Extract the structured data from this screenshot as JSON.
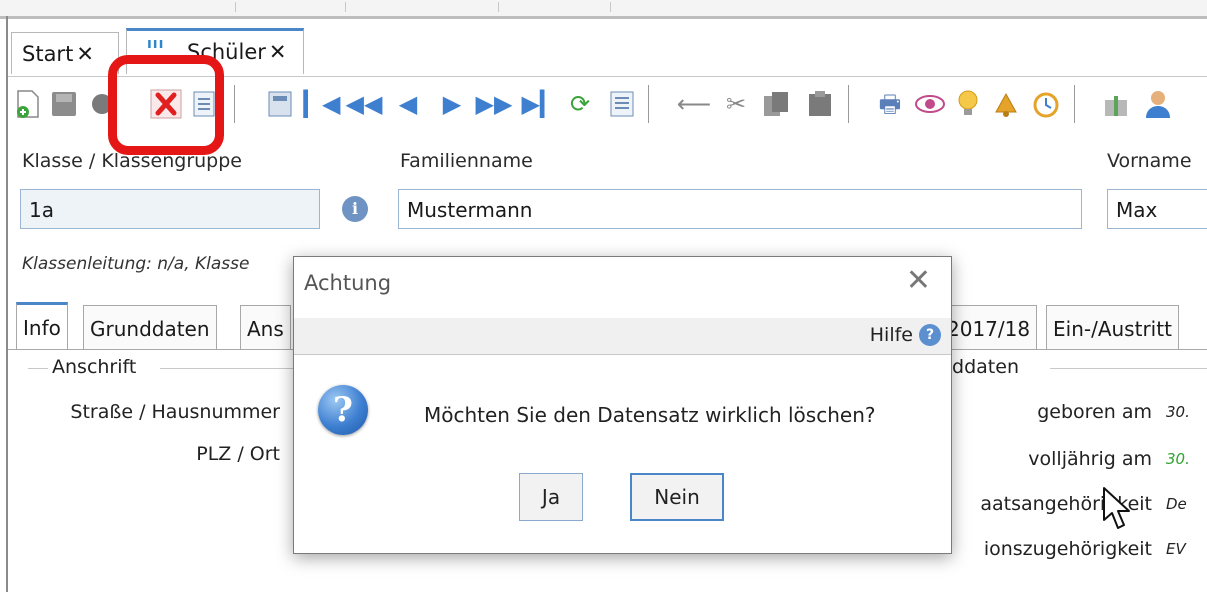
{
  "tabs": [
    {
      "label": "Start",
      "close": "✕"
    },
    {
      "label": "Schüler",
      "close": "✕"
    }
  ],
  "toolbar": {
    "icons": [
      "new-doc-icon",
      "save-icon",
      "undo-icon",
      "delete-icon",
      "edit-icon",
      "calculator-icon",
      "first-icon",
      "prev-page-icon",
      "prev-icon",
      "next-icon",
      "next-page-icon",
      "last-icon",
      "refresh-icon",
      "list-icon",
      "arrow-left-icon",
      "scissors-icon",
      "copy-icon",
      "paste-icon",
      "print-icon",
      "eye-icon",
      "bulb-icon",
      "bell-icon",
      "alarm-icon",
      "gift-icon",
      "user-icon"
    ]
  },
  "form": {
    "klasse_label": "Klasse / Klassengruppe",
    "klasse_value": "1a",
    "familienname_label": "Familienname",
    "familienname_value": "Mustermann",
    "vorname_label": "Vorname",
    "vorname_value": "Max",
    "info": "Klassenleitung: n/a, Klasse"
  },
  "detail_tabs": [
    "Info",
    "Grunddaten",
    "Ans",
    "2017/18",
    "Ein-/Austritt"
  ],
  "sections": {
    "anschrift": "Anschrift",
    "grunddaten": "nddaten",
    "strasse_label": "Straße / Hausnummer",
    "plz_label": "PLZ / Ort",
    "geboren_label": "geboren am",
    "geboren_value": "30.",
    "volljaehrig_label": "volljährig am",
    "volljaehrig_value": "30.",
    "staat_label": "aatsangehörigkeit",
    "staat_value": "De",
    "religion_label": "ionszugehörigkeit",
    "religion_value": "EV"
  },
  "dialog": {
    "title": "Achtung",
    "close": "✕",
    "help": "Hilfe",
    "message": "Möchten Sie den Datensatz wirklich löschen?",
    "yes": "Ja",
    "no": "Nein"
  },
  "colors": {
    "accent": "#4a86c8",
    "highlight": "#e41616",
    "field_bg": "#eef3f8"
  }
}
